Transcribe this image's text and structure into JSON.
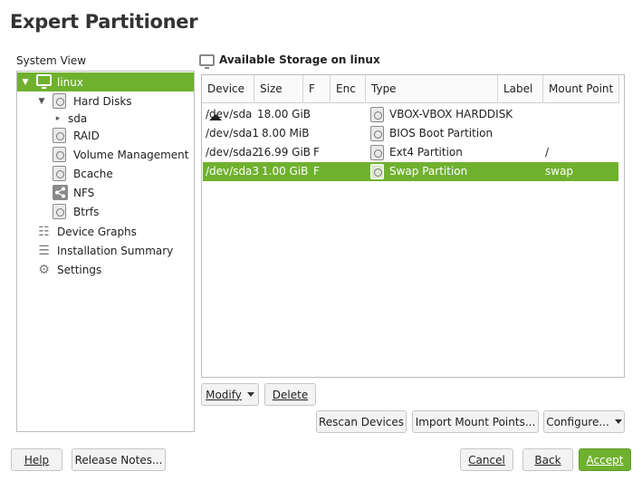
{
  "window": {
    "title": "Expert Partitioner"
  },
  "system_view": {
    "label": "System View",
    "items": [
      {
        "label": "linux"
      },
      {
        "label": "Hard Disks"
      },
      {
        "label": "sda"
      },
      {
        "label": "RAID"
      },
      {
        "label": "Volume Management"
      },
      {
        "label": "Bcache"
      },
      {
        "label": "NFS"
      },
      {
        "label": "Btrfs"
      },
      {
        "label": "Device Graphs"
      },
      {
        "label": "Installation Summary"
      },
      {
        "label": "Settings"
      }
    ]
  },
  "storage": {
    "title": "Available Storage on linux",
    "columns": [
      "Device",
      "Size",
      "F",
      "Enc",
      "Type",
      "Label",
      "Mount Point"
    ],
    "rows": [
      {
        "device": "/dev/sda",
        "size": "18.00 GiB",
        "f": "",
        "enc": "",
        "type": "VBOX-VBOX HARDDISK",
        "label": "",
        "mount": ""
      },
      {
        "device": "/dev/sda1",
        "size": "8.00 MiB",
        "f": "",
        "enc": "",
        "type": "BIOS Boot Partition",
        "label": "",
        "mount": ""
      },
      {
        "device": "/dev/sda2",
        "size": "16.99 GiB",
        "f": "F",
        "enc": "",
        "type": "Ext4 Partition",
        "label": "",
        "mount": "/"
      },
      {
        "device": "/dev/sda3",
        "size": "1.00 GiB",
        "f": "F",
        "enc": "",
        "type": "Swap Partition",
        "label": "",
        "mount": "swap"
      }
    ]
  },
  "buttons": {
    "modify": "Modify",
    "delete": "Delete",
    "rescan": "Rescan Devices",
    "import_mount": "Import Mount Points...",
    "configure": "Configure...",
    "help": "Help",
    "release_notes": "Release Notes...",
    "cancel": "Cancel",
    "back": "Back",
    "accept": "Accept"
  },
  "colors": {
    "accent": "#6fb12f"
  }
}
